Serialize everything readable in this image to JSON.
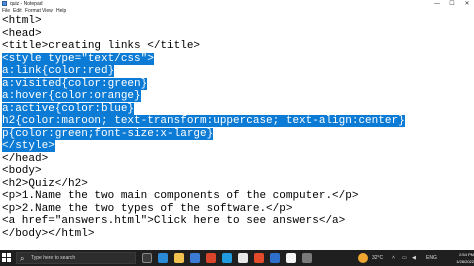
{
  "window": {
    "title": "quiz - Notepad",
    "controls": {
      "minimize": "—",
      "maximize": "☐",
      "close": "✕"
    }
  },
  "menu": [
    "File",
    "Edit",
    "Format",
    "View",
    "Help"
  ],
  "editor": {
    "lines": [
      "<html>",
      "<head>",
      "<title>creating links </title>",
      "<style type=\"text/css\">",
      "a:link{color:red}",
      "a:visited{color:green}",
      "a:hover{color:orange}",
      "a:active{color:blue}",
      "h2{color:maroon; text-transform:uppercase; text-align:center}",
      "p{color:green;font-size:x-large}",
      "</style>",
      "</head>",
      "<body>",
      "<h2>Quiz</h2>",
      "<p>1.Name the two main components of the computer.</p>",
      "<p>2.Name the two types of the software.</p>",
      "<a href=\"answers.html\">Click here to see answers</a>",
      "</body></html>"
    ],
    "selected_lines": [
      3,
      4,
      5,
      6,
      7,
      8,
      9,
      10
    ]
  },
  "taskbar": {
    "search_placeholder": "Type here to search",
    "weather": "32°C",
    "language": "ENG",
    "time": "2:54 PM",
    "date": "1/28/2022",
    "colors": {
      "background": "#1f1f1f",
      "selection": "#0c7bd6"
    }
  }
}
